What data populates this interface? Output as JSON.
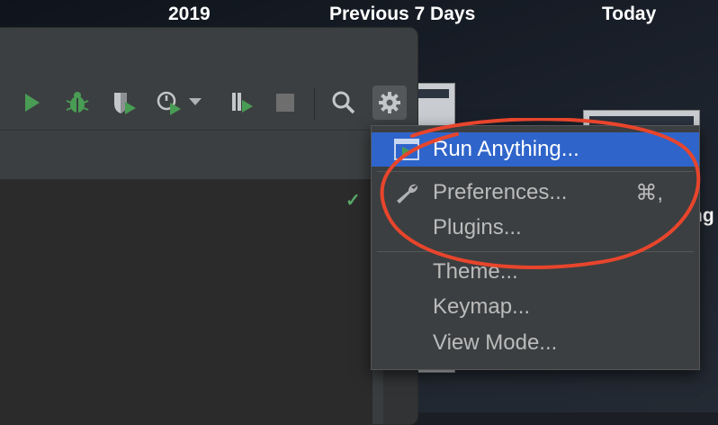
{
  "desktop": {
    "headers": [
      "2019",
      "Previous 7 Days",
      "Today"
    ],
    "partial_text": "ng"
  },
  "toolbar": {
    "buttons": [
      "run",
      "debug",
      "coverage",
      "profile",
      "attach",
      "stop",
      "search",
      "settings"
    ]
  },
  "menu": {
    "items": [
      {
        "label": "Run Anything...",
        "shortcut": "",
        "icon": "run-anything-icon",
        "selected": true
      },
      {
        "label": "Preferences...",
        "shortcut": "⌘,",
        "icon": "wrench-icon",
        "selected": false
      },
      {
        "label": "Plugins...",
        "shortcut": "",
        "icon": "",
        "selected": false
      },
      {
        "label": "Theme...",
        "shortcut": "",
        "icon": "",
        "selected": false
      },
      {
        "label": "Keymap...",
        "shortcut": "",
        "icon": "",
        "selected": false
      },
      {
        "label": "View Mode...",
        "shortcut": "",
        "icon": "",
        "selected": false
      }
    ]
  },
  "colors": {
    "selection": "#2f65ca",
    "run_green": "#499c54",
    "annotation_red": "#e8452c"
  }
}
